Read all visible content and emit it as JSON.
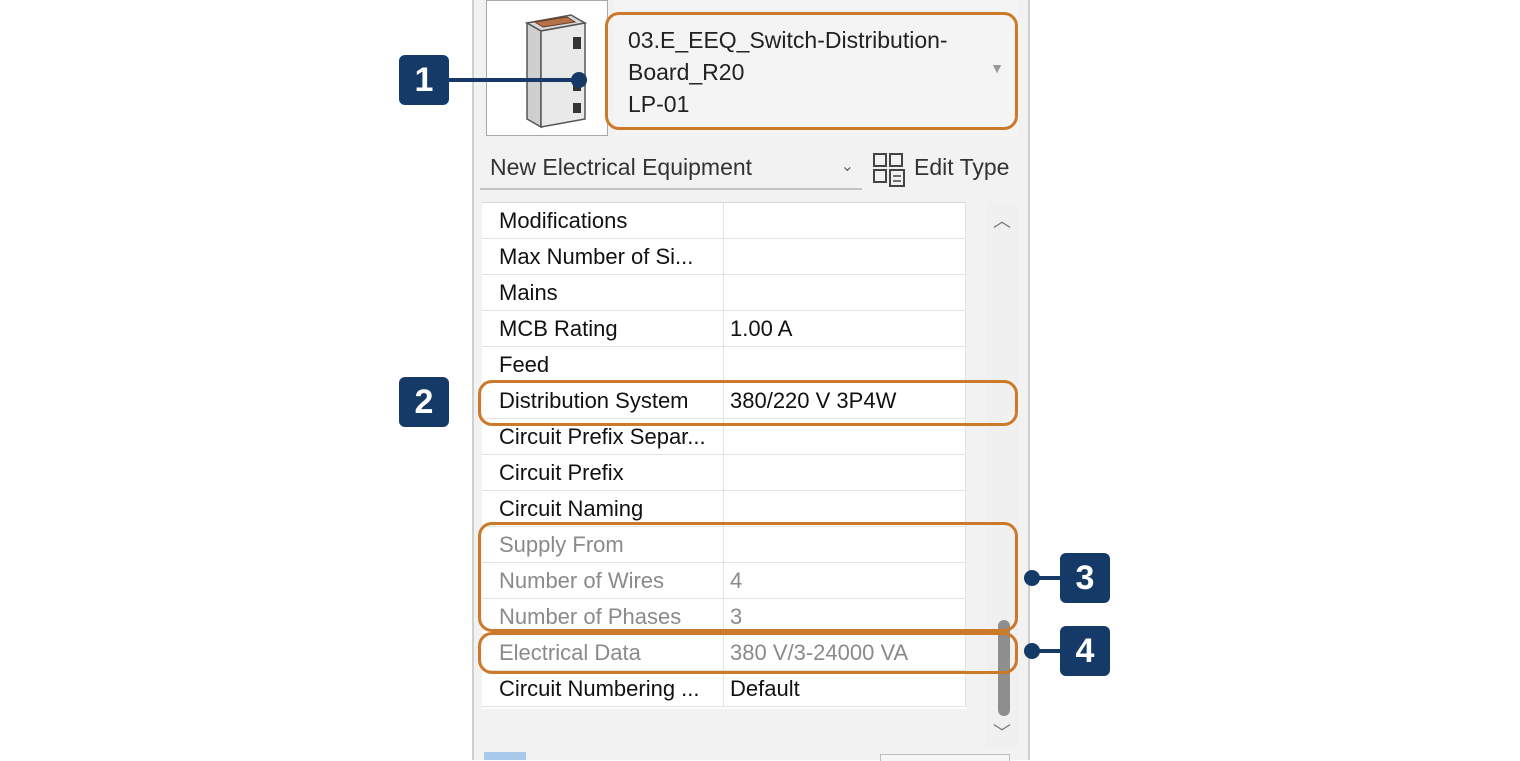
{
  "type_selector": {
    "lines": [
      "03.E_EEQ_Switch-Distribution-",
      "Board_R20",
      "LP-01"
    ]
  },
  "instance_filter": {
    "label": "New Electrical Equipment"
  },
  "edit_type": {
    "label": "Edit Type"
  },
  "properties": [
    {
      "name": "Modifications",
      "value": "",
      "grayed": false
    },
    {
      "name": "Max Number of Si...",
      "value": "",
      "grayed": false
    },
    {
      "name": "Mains",
      "value": "",
      "grayed": false
    },
    {
      "name": "MCB Rating",
      "value": "1.00 A",
      "grayed": false
    },
    {
      "name": "Feed",
      "value": "",
      "grayed": false
    },
    {
      "name": "Distribution System",
      "value": "380/220 V 3P4W",
      "grayed": false
    },
    {
      "name": "Circuit Prefix Separ...",
      "value": "",
      "grayed": false
    },
    {
      "name": "Circuit Prefix",
      "value": "",
      "grayed": false
    },
    {
      "name": "Circuit Naming",
      "value": "",
      "grayed": false
    },
    {
      "name": "Supply From",
      "value": "",
      "grayed": true
    },
    {
      "name": "Number of Wires",
      "value": "4",
      "grayed": true
    },
    {
      "name": "Number of Phases",
      "value": "3",
      "grayed": true
    },
    {
      "name": "Electrical Data",
      "value": "380 V/3-24000 VA",
      "grayed": true
    },
    {
      "name": "Circuit Numbering ...",
      "value": "Default",
      "grayed": false
    }
  ],
  "callouts": [
    "1",
    "2",
    "3",
    "4"
  ],
  "colors": {
    "callout_outline": "#cc7a2a",
    "badge_bg": "#153a68",
    "grayed_text": "#8a8a8a"
  }
}
